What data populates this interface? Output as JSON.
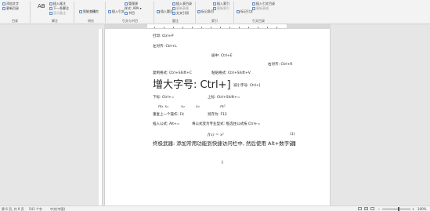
{
  "ribbon": {
    "insert_endnote": "插入尾注",
    "next_footnote": "下一条脚注",
    "show_notes": "显示备注",
    "add_text": "添加文字",
    "update_table": "更新目录",
    "group_toc": "目录",
    "insert_citation": "插入引文",
    "manage_sources": "管理源",
    "style_label": "样式:",
    "style_value": "APA",
    "bibliography": "书目",
    "smart_lookup": "智能查找",
    "research": "研究",
    "insert_caption": "插入题注",
    "insert_table_of_figures": "插入表目录",
    "update_table2": "更新表格",
    "cross_reference": "交叉引用",
    "mark_entry": "标记条目",
    "insert_index": "插入索引",
    "update_index": "更新索引",
    "mark_citation": "标记引文",
    "insert_toa": "插入引文目录",
    "update_toa": "更新表格",
    "group_footnotes": "脚注",
    "group_research": "研究",
    "group_citations": "引文与书目",
    "group_captions": "题注",
    "group_index": "索引",
    "group_toa": "引文目录",
    "footnote_big": "AB"
  },
  "document": {
    "line1": "打印: Ctrl+P",
    "line2": "左对齐: Ctrl+L",
    "line3": "居中: Ctrl+E",
    "line4": "右对齐: Ctrl+R",
    "line5a": "复制格式: Ctrl+Shift+C",
    "line5b": "粘贴格式: Ctrl+Shift+V",
    "line6a": "增大字号: Ctrl+]",
    "line6b": "减小字号: Ctrl+[",
    "line7a": "下标: Ctrl+=",
    "line7b": "上标: Ctrl+Shift+=",
    "line8a": "m₁ x₁",
    "line8b": "x₂",
    "line8c": "x₂",
    "line8d": "m²",
    "line9a": "重复上一个操作: F4",
    "line9b": "另存为: F12",
    "line10a": "插入公式: Alt+=",
    "line10b": "将公式变为专业型式: 框选住公式按 Ctrl+=",
    "formula": "f(x) = x²",
    "formula_num": "(1)",
    "line11": "终极武器: 添加常用功能到快捷访问栏中, 然后使用 Alt+数字键"
  },
  "status": {
    "page": "第 6 页, 共 9 页",
    "words": "541 个字",
    "language": "中文(中国)",
    "zoom": "100%"
  }
}
